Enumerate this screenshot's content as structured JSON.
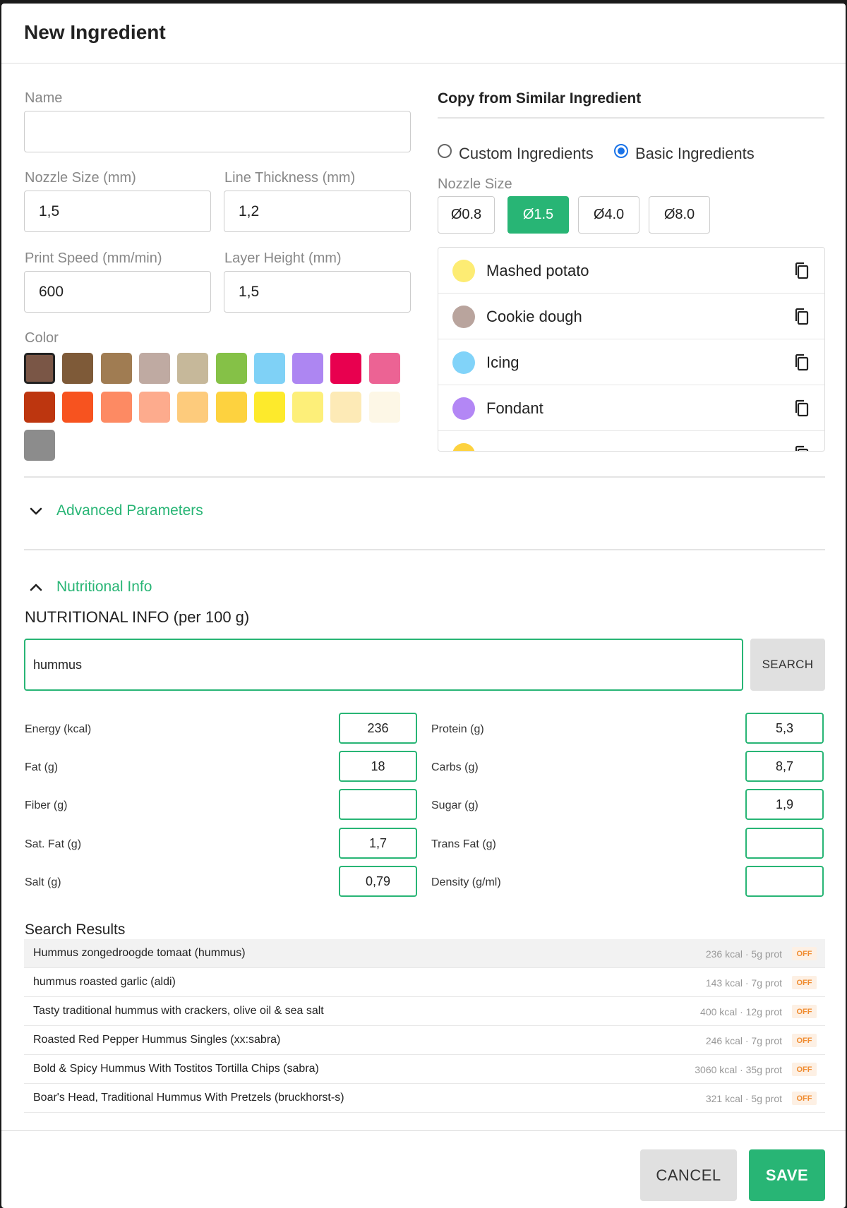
{
  "dialog": {
    "title": "New Ingredient"
  },
  "form": {
    "name": {
      "label": "Name",
      "value": ""
    },
    "nozzle_size": {
      "label": "Nozzle Size (mm)",
      "value": "1,5"
    },
    "line_thickness": {
      "label": "Line Thickness (mm)",
      "value": "1,2"
    },
    "print_speed": {
      "label": "Print Speed (mm/min)",
      "value": "600"
    },
    "layer_height": {
      "label": "Layer Height (mm)",
      "value": "1,5"
    },
    "color": {
      "label": "Color",
      "selected_index": 0,
      "swatches": [
        "#7a5646",
        "#7e5a38",
        "#a07c52",
        "#bfaaa2",
        "#c6b89a",
        "#85c147",
        "#7fd1f6",
        "#ad86f2",
        "#e8004f",
        "#ec6394",
        "#bd360f",
        "#f7531f",
        "#fd8a63",
        "#fdab8d",
        "#fdcb7c",
        "#fdd23f",
        "#fdea2c",
        "#fdef79",
        "#fdeab6",
        "#fdf7e6",
        "#8c8c8c"
      ]
    }
  },
  "copy_panel": {
    "title": "Copy from Similar Ingredient",
    "radio_custom": "Custom Ingredients",
    "radio_basic": "Basic Ingredients",
    "selected_radio": "basic",
    "nozzle_label": "Nozzle Size",
    "nozzle_options": [
      "Ø0.8",
      "Ø1.5",
      "Ø4.0",
      "Ø8.0"
    ],
    "nozzle_active": "Ø1.5",
    "ingredients": [
      {
        "name": "Mashed potato",
        "color": "#fdec73"
      },
      {
        "name": "Cookie dough",
        "color": "#b9a49d"
      },
      {
        "name": "Icing",
        "color": "#81d3f9"
      },
      {
        "name": "Fondant",
        "color": "#b387f5"
      },
      {
        "name": "",
        "color": "#fdd23f"
      }
    ]
  },
  "advanced": {
    "label": "Advanced Parameters",
    "expanded": false
  },
  "nutrition": {
    "accordion_label": "Nutritional Info",
    "expanded": true,
    "title": "NUTRITIONAL INFO (per 100 g)",
    "search_value": "hummus",
    "search_button": "SEARCH",
    "fields_left": [
      {
        "label": "Energy (kcal)",
        "value": "236"
      },
      {
        "label": "Fat (g)",
        "value": "18"
      },
      {
        "label": "Fiber (g)",
        "value": ""
      },
      {
        "label": "Sat. Fat (g)",
        "value": "1,7"
      },
      {
        "label": "Salt (g)",
        "value": "0,79"
      }
    ],
    "fields_right": [
      {
        "label": "Protein (g)",
        "value": "5,3"
      },
      {
        "label": "Carbs (g)",
        "value": "8,7"
      },
      {
        "label": "Sugar (g)",
        "value": "1,9"
      },
      {
        "label": "Trans Fat (g)",
        "value": ""
      },
      {
        "label": "Density (g/ml)",
        "value": ""
      }
    ]
  },
  "results": {
    "title": "Search Results",
    "items": [
      {
        "name": "Hummus zongedroogde tomaat (hummus)",
        "meta": "236 kcal · 5g prot",
        "tag": "OFF"
      },
      {
        "name": "hummus roasted garlic (aldi)",
        "meta": "143 kcal · 7g prot",
        "tag": "OFF"
      },
      {
        "name": "Tasty traditional hummus with crackers, olive oil & sea salt",
        "meta": "400 kcal · 12g prot",
        "tag": "OFF"
      },
      {
        "name": "Roasted Red Pepper Hummus Singles (xx:sabra)",
        "meta": "246 kcal · 7g prot",
        "tag": "OFF"
      },
      {
        "name": "Bold & Spicy Hummus With Tostitos Tortilla Chips (sabra)",
        "meta": "3060 kcal · 35g prot",
        "tag": "OFF"
      },
      {
        "name": "Boar's Head, Traditional Hummus With Pretzels (bruckhorst-s)",
        "meta": "321 kcal · 5g prot",
        "tag": "OFF"
      },
      {
        "name": "",
        "meta": "",
        "tag": ""
      }
    ]
  },
  "footer": {
    "cancel": "CANCEL",
    "save": "SAVE"
  },
  "colors": {
    "accent": "#28b575",
    "radio": "#1a73e8"
  }
}
